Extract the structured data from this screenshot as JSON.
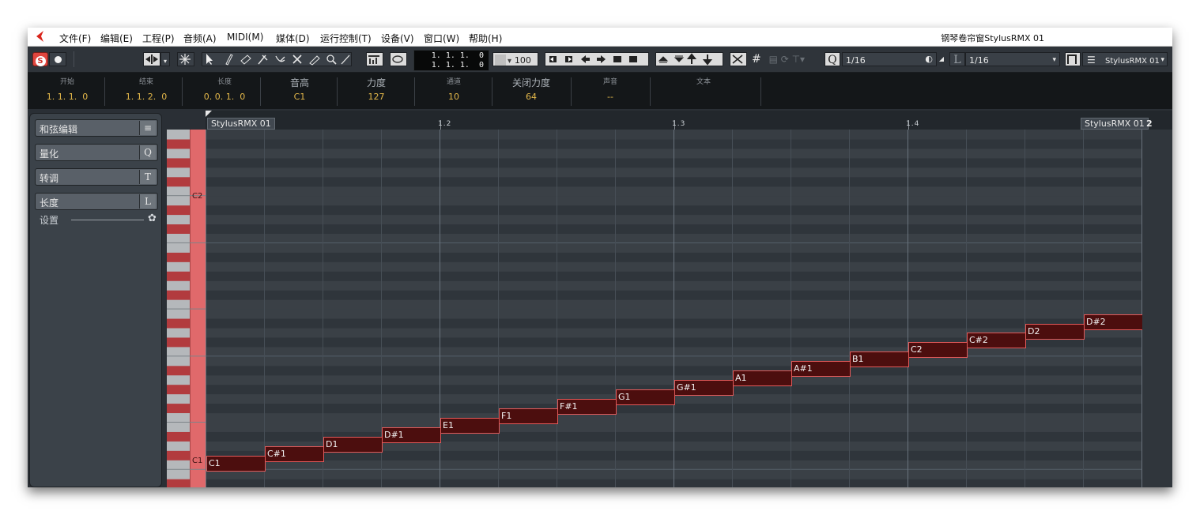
{
  "menubar": {
    "items": [
      "文件(F)",
      "编辑(E)",
      "工程(P)",
      "音频(A)",
      "MIDI(M)",
      "媒体(D)",
      "运行控制(T)",
      "设备(V)",
      "窗口(W)",
      "帮助(H)"
    ],
    "window_title": "钢琴卷帘窗StylusRMX 01"
  },
  "toolbar": {
    "solo_label": "S",
    "position_top": "1. 1. 1.  0",
    "position_bottom": "1. 1. 1.  0",
    "velocity_value": "100",
    "quantize_icon": "Q",
    "quantize_value": "1/16",
    "length_icon": "L",
    "length_value": "1/16",
    "track_name": "StylusRMX 01"
  },
  "infoline": {
    "columns": [
      {
        "header": "开始",
        "value": "1. 1. 1.  0"
      },
      {
        "header": "结束",
        "value": "1. 1. 2.  0"
      },
      {
        "header": "长度",
        "value": "0. 0. 1.  0"
      },
      {
        "header": "音高",
        "value": "C1"
      },
      {
        "header": "力度",
        "value": "127"
      },
      {
        "header": "通道",
        "value": "10"
      },
      {
        "header": "关闭力度",
        "value": "64"
      },
      {
        "header": "声音",
        "value": "--"
      },
      {
        "header": "文本",
        "value": ""
      }
    ]
  },
  "left_panel": {
    "sections": [
      {
        "label": "和弦编辑",
        "key": "≡"
      },
      {
        "label": "量化",
        "key": "Q"
      },
      {
        "label": "转调",
        "key": "T"
      },
      {
        "label": "长度",
        "key": "L"
      }
    ],
    "settings_label": "设置"
  },
  "ruler": {
    "bars": [
      "1.2",
      "1.3",
      "1.4",
      "2"
    ],
    "event_label_start": "StylusRMX 01",
    "event_label_end": "StylusRMX 01"
  },
  "piano": {
    "labels": [
      "C2",
      "C1"
    ]
  },
  "notes": [
    {
      "pitch": "C1",
      "step": 0
    },
    {
      "pitch": "C#1",
      "step": 1
    },
    {
      "pitch": "D1",
      "step": 2
    },
    {
      "pitch": "D#1",
      "step": 3
    },
    {
      "pitch": "E1",
      "step": 4
    },
    {
      "pitch": "F1",
      "step": 5
    },
    {
      "pitch": "F#1",
      "step": 6
    },
    {
      "pitch": "G1",
      "step": 7
    },
    {
      "pitch": "G#1",
      "step": 8
    },
    {
      "pitch": "A1",
      "step": 9
    },
    {
      "pitch": "A#1",
      "step": 10
    },
    {
      "pitch": "B1",
      "step": 11
    },
    {
      "pitch": "C2",
      "step": 12
    },
    {
      "pitch": "C#2",
      "step": 13
    },
    {
      "pitch": "D2",
      "step": 14
    },
    {
      "pitch": "D#2",
      "step": 15
    }
  ],
  "colors": {
    "note_fill": "#4c0e0e",
    "note_border": "#e25a5a",
    "info_value": "#e4b84a",
    "solo_red": "#e0463e"
  }
}
